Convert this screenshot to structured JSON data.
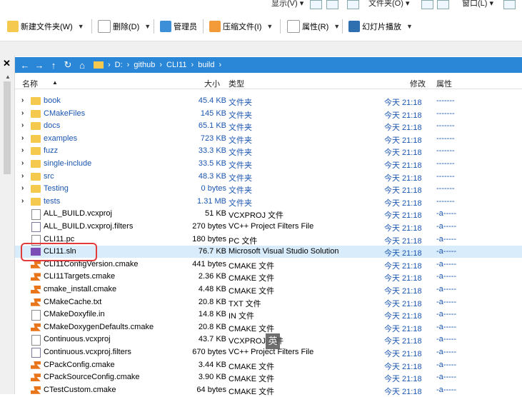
{
  "menubar": {
    "view": "显示(V) ▾",
    "folder": "文件夹(O) ▾",
    "window": "窗口(L) ▾"
  },
  "toolbar": {
    "new_folder": "新建文件夹(W)",
    "delete": "删除(D)",
    "admin": "管理员",
    "compress": "压缩文件(I)",
    "properties": "属性(R)",
    "slideshow": "幻灯片播放"
  },
  "address": {
    "crumbs": [
      "D:",
      "github",
      "CLI11",
      "build"
    ],
    "separator": "›"
  },
  "columns": {
    "name": "名称",
    "size": "大小",
    "type": "类型",
    "modified": "修改",
    "attr": "属性"
  },
  "rows": [
    {
      "name": "book",
      "size": "45.4 KB",
      "type": "文件夹",
      "modified": "今天 21:18",
      "attr": "-------",
      "kind": "dir"
    },
    {
      "name": "CMakeFiles",
      "size": "145 KB",
      "type": "文件夹",
      "modified": "今天 21:18",
      "attr": "-------",
      "kind": "dir"
    },
    {
      "name": "docs",
      "size": "65.1 KB",
      "type": "文件夹",
      "modified": "今天 21:18",
      "attr": "-------",
      "kind": "dir"
    },
    {
      "name": "examples",
      "size": "723 KB",
      "type": "文件夹",
      "modified": "今天 21:18",
      "attr": "-------",
      "kind": "dir"
    },
    {
      "name": "fuzz",
      "size": "33.3 KB",
      "type": "文件夹",
      "modified": "今天 21:18",
      "attr": "-------",
      "kind": "dir"
    },
    {
      "name": "single-include",
      "size": "33.5 KB",
      "type": "文件夹",
      "modified": "今天 21:18",
      "attr": "-------",
      "kind": "dir"
    },
    {
      "name": "src",
      "size": "48.3 KB",
      "type": "文件夹",
      "modified": "今天 21:18",
      "attr": "-------",
      "kind": "dir"
    },
    {
      "name": "Testing",
      "size": "0 bytes",
      "type": "文件夹",
      "modified": "今天 21:18",
      "attr": "-------",
      "kind": "dir"
    },
    {
      "name": "tests",
      "size": "1.31 MB",
      "type": "文件夹",
      "modified": "今天 21:18",
      "attr": "-------",
      "kind": "dir"
    },
    {
      "name": "ALL_BUILD.vcxproj",
      "size": "51 KB",
      "type": "VCXPROJ 文件",
      "modified": "今天 21:18",
      "attr": "-a-----",
      "kind": "doc"
    },
    {
      "name": "ALL_BUILD.vcxproj.filters",
      "size": "270 bytes",
      "type": "VC++ Project Filters File",
      "modified": "今天 21:18",
      "attr": "-a-----",
      "kind": "filt"
    },
    {
      "name": "CLI11.pc",
      "size": "180 bytes",
      "type": "PC 文件",
      "modified": "今天 21:18",
      "attr": "-a-----",
      "kind": "doc"
    },
    {
      "name": "CLI11.sln",
      "size": "76.7 KB",
      "type": "Microsoft Visual Studio Solution",
      "modified": "今天 21:18",
      "attr": "-a-----",
      "kind": "sln"
    },
    {
      "name": "CLI11ConfigVersion.cmake",
      "size": "441 bytes",
      "type": "CMAKE 文件",
      "modified": "今天 21:18",
      "attr": "-a-----",
      "kind": "cmk"
    },
    {
      "name": "CLI11Targets.cmake",
      "size": "2.36 KB",
      "type": "CMAKE 文件",
      "modified": "今天 21:18",
      "attr": "-a-----",
      "kind": "cmk"
    },
    {
      "name": "cmake_install.cmake",
      "size": "4.48 KB",
      "type": "CMAKE 文件",
      "modified": "今天 21:18",
      "attr": "-a-----",
      "kind": "cmk"
    },
    {
      "name": "CMakeCache.txt",
      "size": "20.8 KB",
      "type": "TXT 文件",
      "modified": "今天 21:18",
      "attr": "-a-----",
      "kind": "cmk"
    },
    {
      "name": "CMakeDoxyfile.in",
      "size": "14.8 KB",
      "type": "IN 文件",
      "modified": "今天 21:18",
      "attr": "-a-----",
      "kind": "doc"
    },
    {
      "name": "CMakeDoxygenDefaults.cmake",
      "size": "20.8 KB",
      "type": "CMAKE 文件",
      "modified": "今天 21:18",
      "attr": "-a-----",
      "kind": "cmk"
    },
    {
      "name": "Continuous.vcxproj",
      "size": "43.7 KB",
      "type": "VCXPROJ 文件",
      "modified": "今天 21:18",
      "attr": "-a-----",
      "kind": "doc"
    },
    {
      "name": "Continuous.vcxproj.filters",
      "size": "670 bytes",
      "type": "VC++ Project Filters File",
      "modified": "今天 21:18",
      "attr": "-a-----",
      "kind": "filt"
    },
    {
      "name": "CPackConfig.cmake",
      "size": "3.44 KB",
      "type": "CMAKE 文件",
      "modified": "今天 21:18",
      "attr": "-a-----",
      "kind": "cmk"
    },
    {
      "name": "CPackSourceConfig.cmake",
      "size": "3.90 KB",
      "type": "CMAKE 文件",
      "modified": "今天 21:18",
      "attr": "-a-----",
      "kind": "cmk"
    },
    {
      "name": "CTestCustom.cmake",
      "size": "64 bytes",
      "type": "CMAKE 文件",
      "modified": "今天 21:18",
      "attr": "-a-----",
      "kind": "cmk"
    }
  ],
  "selected_row": "CLI11.sln",
  "ime_indicator": "英",
  "colors": {
    "accent": "#2a86d6",
    "selection": "#d9ecfb",
    "highlight": "#e23b3b",
    "folder": "#f5c94e"
  }
}
